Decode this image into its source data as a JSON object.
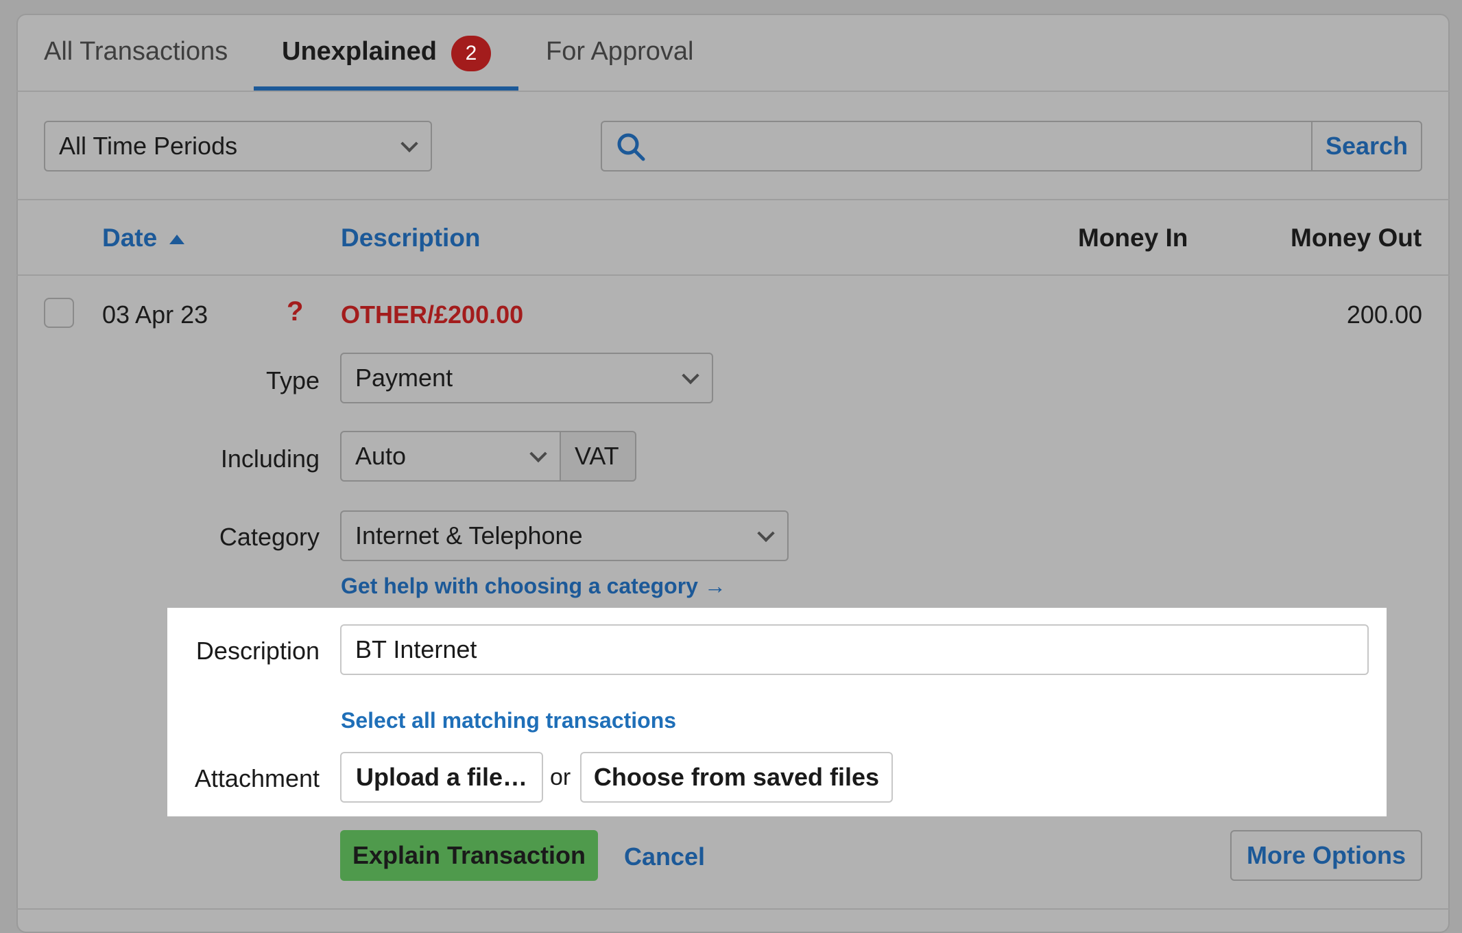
{
  "tabs": [
    {
      "label": "All Transactions"
    },
    {
      "label": "Unexplained",
      "badge": "2"
    },
    {
      "label": "For Approval"
    }
  ],
  "filters": {
    "period_value": "All Time Periods",
    "search_value": "",
    "search_button": "Search"
  },
  "columns": {
    "date": "Date",
    "description": "Description",
    "money_in": "Money In",
    "money_out": "Money Out"
  },
  "transaction": {
    "date": "03 Apr 23",
    "status_glyph": "?",
    "description": "OTHER/£200.00",
    "money_out": "200.00"
  },
  "form": {
    "type_label": "Type",
    "type_value": "Payment",
    "including_label": "Including",
    "including_value": "Auto",
    "vat_label": "VAT",
    "category_label": "Category",
    "category_value": "Internet & Telephone",
    "category_help_link": "Get help with choosing a category →",
    "description_label": "Description",
    "description_value": "BT Internet",
    "select_matching_link": "Select all matching transactions",
    "attachment_label": "Attachment",
    "upload_button": "Upload a file…",
    "or_text": "or",
    "saved_files_button": "Choose from saved files"
  },
  "actions": {
    "explain": "Explain Transaction",
    "cancel": "Cancel",
    "more_options": "More Options"
  },
  "colors": {
    "accent_blue": "#1c5998",
    "error_red": "#a31c1c",
    "success_green": "#4f9a4c"
  }
}
